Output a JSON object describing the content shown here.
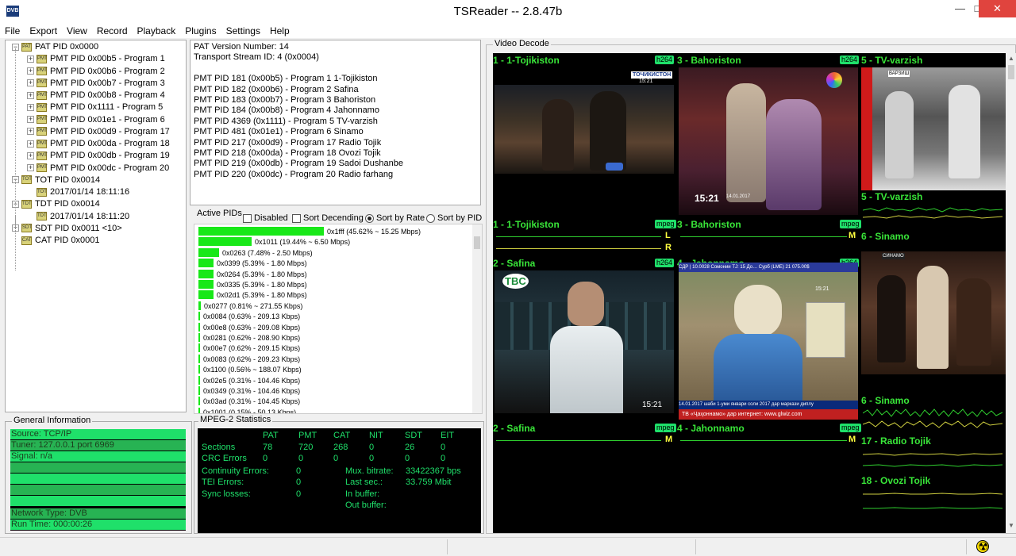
{
  "window": {
    "title": "TSReader -- 2.8.47b",
    "logo_text": "DVB"
  },
  "menu": [
    "File",
    "Export",
    "View",
    "Record",
    "Playback",
    "Plugins",
    "Settings",
    "Help"
  ],
  "tree": [
    {
      "label": "PAT PID 0x0000",
      "icon": "PAT",
      "expander": "−",
      "level": 0
    },
    {
      "label": "PMT PID 0x00b5 - Program 1",
      "icon": "PMT",
      "expander": "+",
      "level": 1
    },
    {
      "label": "PMT PID 0x00b6 - Program 2",
      "icon": "PMT",
      "expander": "+",
      "level": 1
    },
    {
      "label": "PMT PID 0x00b7 - Program 3",
      "icon": "PMT",
      "expander": "+",
      "level": 1
    },
    {
      "label": "PMT PID 0x00b8 - Program 4",
      "icon": "PMT",
      "expander": "+",
      "level": 1
    },
    {
      "label": "PMT PID 0x1111 - Program 5",
      "icon": "PMT",
      "expander": "+",
      "level": 1
    },
    {
      "label": "PMT PID 0x01e1 - Program 6",
      "icon": "PMT",
      "expander": "+",
      "level": 1
    },
    {
      "label": "PMT PID 0x00d9 - Program 17",
      "icon": "PMT",
      "expander": "+",
      "level": 1
    },
    {
      "label": "PMT PID 0x00da - Program 18",
      "icon": "PMT",
      "expander": "+",
      "level": 1
    },
    {
      "label": "PMT PID 0x00db - Program 19",
      "icon": "PMT",
      "expander": "+",
      "level": 1
    },
    {
      "label": "PMT PID 0x00dc - Program 20",
      "icon": "PMT",
      "expander": "+",
      "level": 1
    },
    {
      "label": "TOT PID 0x0014",
      "icon": "TOT",
      "expander": "−",
      "level": 0
    },
    {
      "label": "2017/01/14 18:11:16",
      "icon": "TOT",
      "expander": "",
      "level": 1
    },
    {
      "label": "TDT PID 0x0014",
      "icon": "TDT",
      "expander": "−",
      "level": 0
    },
    {
      "label": "2017/01/14 18:11:20",
      "icon": "TDT",
      "expander": "",
      "level": 1
    },
    {
      "label": "SDT PID 0x0011 <10>",
      "icon": "SDT",
      "expander": "+",
      "level": 0
    },
    {
      "label": "CAT PID 0x0001",
      "icon": "CAT",
      "expander": "",
      "level": 0
    }
  ],
  "pat_details": [
    "PAT Version Number: 14",
    "Transport Stream ID: 4 (0x0004)",
    "",
    "PMT PID 181 (0x00b5) - Program 1 1-Tojikiston",
    "PMT PID 182 (0x00b6) - Program 2 Safina",
    "PMT PID 183 (0x00b7) - Program 3 Bahoriston",
    "PMT PID 184 (0x00b8) - Program 4 Jahonnamo",
    "PMT PID 4369 (0x1111) - Program 5 TV-varzish",
    "PMT PID 481 (0x01e1) - Program 6 Sinamo",
    "PMT PID 217 (0x00d9) - Program 17 Radio Tojik",
    "PMT PID 218 (0x00da) - Program 18 Ovozi Tojik",
    "PMT PID 219 (0x00db) - Program 19 Sadoi Dushanbe",
    "PMT PID 220 (0x00dc) - Program 20 Radio farhang"
  ],
  "active_pids": {
    "label": "Active PIDs",
    "options": [
      {
        "label": "Disabled",
        "type": "checkbox",
        "checked": false
      },
      {
        "label": "Sort Decending",
        "type": "checkbox",
        "checked": false
      },
      {
        "label": "Sort by Rate",
        "type": "radio",
        "checked": true
      },
      {
        "label": "Sort by PID",
        "type": "radio",
        "checked": false
      }
    ],
    "rows": [
      {
        "text": "0x1fff (45.62% ~ 15.25 Mbps)",
        "percent": 45.62
      },
      {
        "text": "0x1011 (19.44% ~ 6.50 Mbps)",
        "percent": 19.44
      },
      {
        "text": "0x0263 (7.48% - 2.50 Mbps)",
        "percent": 7.48
      },
      {
        "text": "0x0399 (5.39% - 1.80 Mbps)",
        "percent": 5.39
      },
      {
        "text": "0x0264 (5.39% - 1.80 Mbps)",
        "percent": 5.39
      },
      {
        "text": "0x0335 (5.39% - 1.80 Mbps)",
        "percent": 5.39
      },
      {
        "text": "0x02d1 (5.39% - 1.80 Mbps)",
        "percent": 5.39
      },
      {
        "text": "0x0277 (0.81% ~ 271.55 Kbps)",
        "percent": 0.81
      },
      {
        "text": "0x0084 (0.63% - 209.13 Kbps)",
        "percent": 0.63
      },
      {
        "text": "0x00e8 (0.63% - 209.08 Kbps)",
        "percent": 0.63
      },
      {
        "text": "0x0281 (0.62% - 208.90 Kbps)",
        "percent": 0.62
      },
      {
        "text": "0x00e7 (0.62% - 209.15 Kbps)",
        "percent": 0.62
      },
      {
        "text": "0x0083 (0.62% - 209.23 Kbps)",
        "percent": 0.62
      },
      {
        "text": "0x1100 (0.56% ~ 188.07 Kbps)",
        "percent": 0.56
      },
      {
        "text": "0x02e5 (0.31% - 104.46 Kbps)",
        "percent": 0.31
      },
      {
        "text": "0x0349 (0.31% - 104.46 Kbps)",
        "percent": 0.31
      },
      {
        "text": "0x03ad (0.31% - 104.45 Kbps)",
        "percent": 0.31
      },
      {
        "text": "0x1001 (0.15% - 50.13 Kbps)",
        "percent": 0.15
      }
    ]
  },
  "general_info": {
    "title": "General Information",
    "rows": [
      "Source: TCP/IP",
      "Tuner: 127.0.0.1 port 6969",
      "Signal: n/a",
      "",
      "",
      "",
      "",
      "Network Type: DVB",
      "Run Time: 000:00:26"
    ]
  },
  "mpeg_stats": {
    "title": "MPEG-2 Statistics",
    "columns": [
      "PAT",
      "PMT",
      "CAT",
      "NIT",
      "SDT",
      "EIT"
    ],
    "sections_label": "Sections",
    "sections": [
      "78",
      "720",
      "268",
      "0",
      "26",
      "0"
    ],
    "crc_label": "CRC Errors",
    "crc": [
      "0",
      "0",
      "0",
      "0",
      "0",
      "0"
    ],
    "continuity_label": "Continuity Errors:",
    "continuity": "0",
    "tei_label": "TEI Errors:",
    "tei": "0",
    "sync_label": "Sync losses:",
    "sync": "0",
    "mux_label": "Mux. bitrate:",
    "mux": "33422367 bps",
    "last_label": "Last sec.:",
    "last": "33.759 Mbit",
    "inbuf_label": "In buffer:",
    "outbuf_label": "Out buffer:"
  },
  "video_decode": {
    "label": "Video Decode",
    "video_tiles": [
      {
        "title": "1 - 1-Tojikiston",
        "codec": "h264",
        "overlay_logo": "ТОЧИКИСТОН",
        "overlay_time": "15:21"
      },
      {
        "title": "3 - Bahoriston",
        "codec": "h264",
        "overlay_time": "15:21",
        "overlay_date": "14.01.2017"
      },
      {
        "title": "5 - TV-varzish",
        "codec": "h264",
        "overlay_logo": "ВАРЗИШ"
      },
      {
        "title": "2 - Safina",
        "codec": "h264",
        "overlay_logo": "TBC",
        "overlay_time": "15:21"
      },
      {
        "title": "4 - Jahonnamo",
        "codec": "h264",
        "ticker_top": "СДР | 10.0028 Сомонии ТЈ: 15 До…  Сурб (LME) 21 075.00$",
        "ticker_bottom": "14.01.2017 шаби 1-уми январи соли 2017 дар маркази диплу",
        "ticker_url": "ТВ «Ҷаҳоннамо» дар интернет: www.glwiz.com",
        "overlay_time": "15:21"
      },
      {
        "title": "6 - Sinamo",
        "codec": "",
        "overlay_logo": "СИНАМО"
      }
    ],
    "audio_tiles": [
      {
        "title": "1 - 1-Tojikiston",
        "codec": "mpeg",
        "channels": [
          "L",
          "R"
        ]
      },
      {
        "title": "3 - Bahoriston",
        "codec": "mpeg",
        "channels": [
          "M"
        ]
      },
      {
        "title": "5 - TV-varzish",
        "codec": "",
        "channels": []
      },
      {
        "title": "6 - Sinamo",
        "codec": "",
        "channels": []
      },
      {
        "title": "6 - Sinamo",
        "codec": "",
        "channels": []
      },
      {
        "title": "2 - Safina",
        "codec": "mpeg",
        "channels": [
          "M"
        ]
      },
      {
        "title": "4 - Jahonnamo",
        "codec": "mpeg",
        "channels": [
          "M"
        ]
      },
      {
        "title": "17 - Radio Tojik",
        "codec": "",
        "channels": []
      },
      {
        "title": "18 - Ovozi Tojik",
        "codec": "",
        "channels": []
      }
    ]
  },
  "colors": {
    "accent_green": "#1fe06a",
    "bar_green": "#18e818",
    "label_green": "#39e639",
    "close_red": "#e0443e"
  }
}
